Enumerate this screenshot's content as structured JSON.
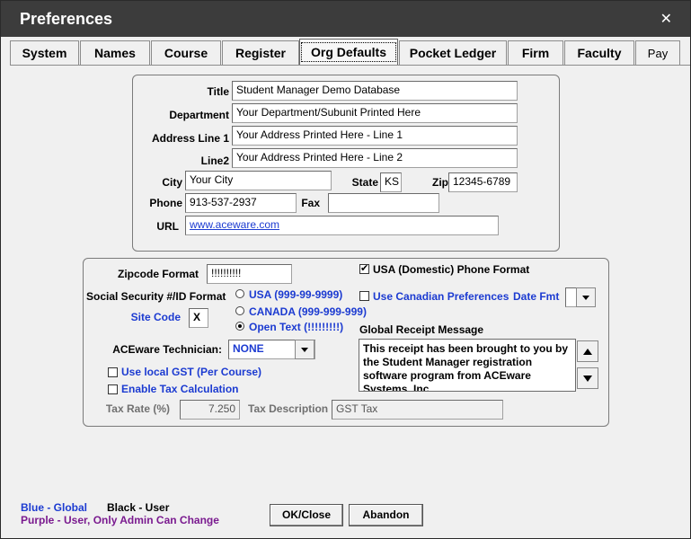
{
  "window": {
    "title": "Preferences",
    "close_symbol": "✕"
  },
  "tabs": [
    {
      "label": "System"
    },
    {
      "label": "Names"
    },
    {
      "label": "Course"
    },
    {
      "label": "Register"
    },
    {
      "label": "Org Defaults"
    },
    {
      "label": "Pocket Ledger"
    },
    {
      "label": "Firm"
    },
    {
      "label": "Faculty"
    },
    {
      "label": "Pay"
    }
  ],
  "org": {
    "title_label": "Title",
    "title_value": "Student Manager Demo Database",
    "department_label": "Department",
    "department_value": "Your Department/Subunit Printed Here",
    "address1_label": "Address Line 1",
    "address1_value": "Your Address Printed Here - Line 1",
    "address2_label": "Line2",
    "address2_value": "Your Address Printed Here - Line 2",
    "city_label": "City",
    "city_value": "Your City",
    "state_label": "State",
    "state_value": "KS",
    "zip_label": "Zip",
    "zip_value": "12345-6789",
    "phone_label": "Phone",
    "phone_value": "913-537-2937",
    "fax_label": "Fax",
    "fax_value": "",
    "url_label": "URL",
    "url_value": "www.aceware.com"
  },
  "formats": {
    "zipcode_label": "Zipcode Format",
    "zipcode_value": "!!!!!!!!!!",
    "ssn_label": "Social Security #/ID Format",
    "ssn_options": [
      "USA (999-99-9999)",
      "CANADA (999-999-999)",
      "Open Text (!!!!!!!!!)"
    ],
    "ssn_selected": 2,
    "site_code_label": "Site Code",
    "site_code_value": "X",
    "technician_label": "ACEware Technician:",
    "technician_value": "NONE",
    "local_gst_label": "Use local GST (Per Course)",
    "enable_tax_label": "Enable Tax Calculation",
    "tax_rate_label": "Tax Rate (%)",
    "tax_rate_value": "7.250",
    "tax_desc_label": "Tax Description",
    "tax_desc_value": "GST Tax",
    "usa_phone_label": "USA (Domestic) Phone Format",
    "usa_phone_checked": true,
    "canadian_label": "Use Canadian Preferences",
    "canadian_checked": false,
    "date_fmt_label": "Date Fmt",
    "date_fmt_value": "",
    "receipt_label": "Global Receipt Message",
    "receipt_value": "This receipt has been brought to you by the Student Manager registration software program from ACEware Systems, Inc."
  },
  "legend": {
    "blue": "Blue - Global",
    "black": "Black - User",
    "purple": "Purple - User, Only Admin Can Change"
  },
  "buttons": {
    "ok": "OK/Close",
    "abandon": "Abandon"
  },
  "colors": {
    "global": "#1c3bd1",
    "admin": "#7a1a8f",
    "titlebar": "#3c3c3c"
  }
}
